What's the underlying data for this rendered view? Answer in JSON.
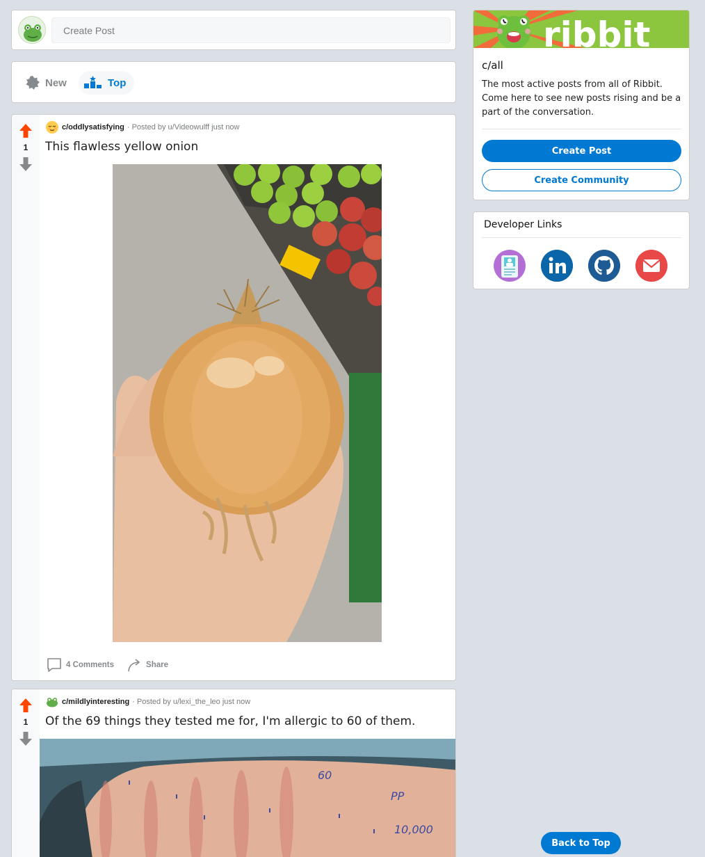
{
  "create_post": {
    "placeholder": "Create Post"
  },
  "sort": {
    "new_label": "New",
    "top_label": "Top",
    "active": "Top"
  },
  "posts": [
    {
      "community": "c/oddlysatisfying",
      "posted_by": "· Posted by u/Videowulff just now",
      "votes": "1",
      "title": "This flawless yellow onion",
      "comments_label": "4 Comments",
      "share_label": "Share"
    },
    {
      "community": "c/mildlyinteresting",
      "posted_by": "· Posted by u/lexi_the_leo just now",
      "votes": "1",
      "title": "Of the 69 things they tested me for, I'm allergic to 60 of them."
    }
  ],
  "sidebar": {
    "brand": "ribbit",
    "community_name": "c/all",
    "description": "The most active posts from all of Ribbit. Come here to see new posts rising and be a part of the conversation.",
    "create_post_label": "Create Post",
    "create_community_label": "Create Community",
    "developer_heading": "Developer Links",
    "dev_links": [
      "portfolio-icon",
      "linkedin-icon",
      "github-icon",
      "email-icon"
    ]
  },
  "back_to_top_label": "Back to Top",
  "colors": {
    "accent": "#0079d3",
    "upvote": "#ff4500",
    "brand_green": "#8cc63f",
    "background": "#dae0e6"
  }
}
